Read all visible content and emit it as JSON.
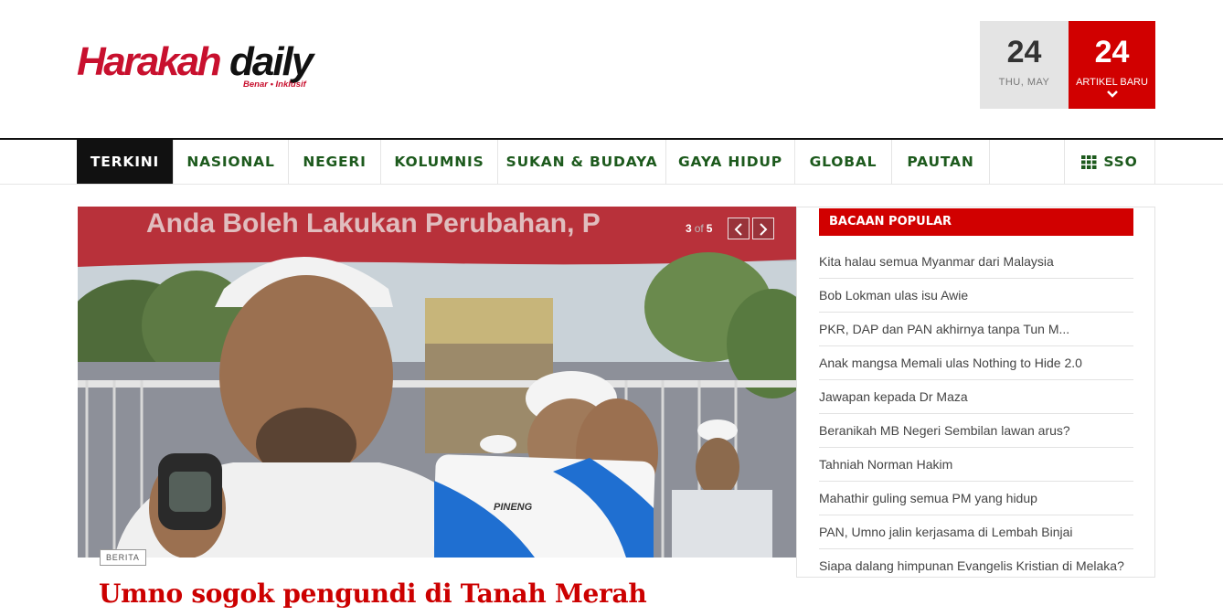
{
  "header": {
    "logo_text": "Harakahdaily",
    "logo_tagline": "Benar • Inklusif",
    "date_day": "24",
    "date_label": "THU, MAY",
    "article_count": "24",
    "article_label": "ARTIKEL BARU",
    "brand_red": "#d10000"
  },
  "nav": {
    "items": [
      "TERKINI",
      "NASIONAL",
      "NEGERI",
      "KOLUMNIS",
      "SUKAN & BUDAYA",
      "GAYA HIDUP",
      "GLOBAL",
      "PAUTAN"
    ],
    "active": "TERKINI",
    "sso_label": "SSO",
    "sso_icon": "grid-icon",
    "nav_green": "#1d5a1d"
  },
  "hero": {
    "slide_current": "3",
    "slide_of": "of",
    "slide_total": "5",
    "badge": "BERITA",
    "headline": "Umno sogok pengundi di Tanah Merah",
    "banner_text": "Anda Boleh Lakukan Perubahan, P",
    "device_label": "PINENG",
    "prev_icon": "chevron-left-icon",
    "next_icon": "chevron-right-icon"
  },
  "sidebar": {
    "title": "BACAAN POPULAR",
    "items": [
      "Kita halau semua Myanmar dari Malaysia",
      "Bob Lokman ulas isu Awie",
      "PKR, DAP dan PAN akhirnya tanpa Tun M...",
      "Anak mangsa Memali ulas Nothing to Hide 2.0",
      "Jawapan kepada Dr Maza",
      "Beranikah MB Negeri Sembilan lawan arus?",
      "Tahniah Norman Hakim",
      "Mahathir guling semua PM yang hidup",
      "PAN, Umno jalin kerjasama di Lembah Binjai",
      "Siapa dalang himpunan Evangelis Kristian di Melaka?"
    ]
  }
}
